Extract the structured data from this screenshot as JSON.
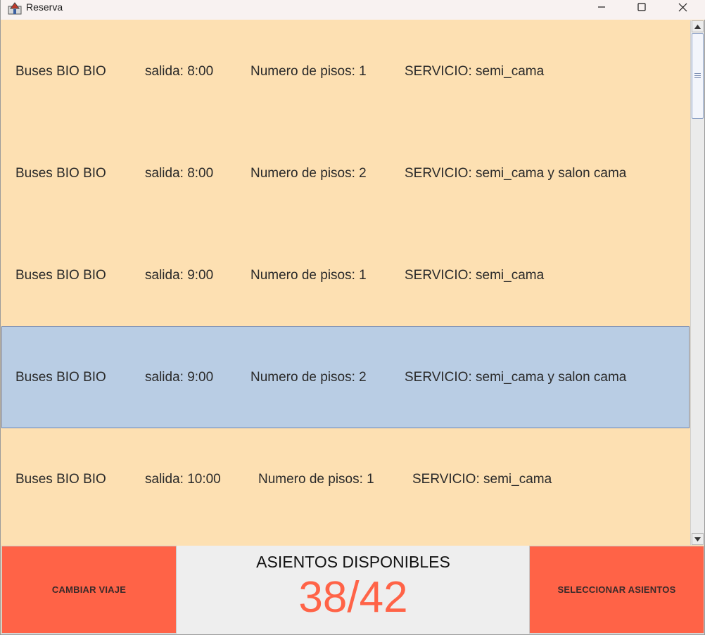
{
  "window": {
    "title": "Reserva",
    "icons": {
      "app": "java-app-icon",
      "minimize": "minimize-icon",
      "maximize": "maximize-icon",
      "close": "close-icon"
    }
  },
  "trips": [
    {
      "company": "Buses BIO BIO",
      "departure": "salida: 8:00",
      "floors": "Numero de pisos: 1",
      "service": "SERVICIO: semi_cama",
      "selected": false
    },
    {
      "company": "Buses BIO BIO",
      "departure": "salida: 8:00",
      "floors": "Numero de pisos: 2",
      "service": "SERVICIO: semi_cama y salon cama",
      "selected": false
    },
    {
      "company": "Buses BIO BIO",
      "departure": "salida: 9:00",
      "floors": "Numero de pisos: 1",
      "service": "SERVICIO: semi_cama",
      "selected": false
    },
    {
      "company": "Buses BIO BIO",
      "departure": "salida: 9:00",
      "floors": "Numero de pisos: 2",
      "service": "SERVICIO: semi_cama y salon cama",
      "selected": true
    },
    {
      "company": "Buses BIO BIO",
      "departure": "salida: 10:00",
      "floors": "Numero de pisos: 1",
      "service": "SERVICIO: semi_cama",
      "selected": false
    }
  ],
  "footer": {
    "change_trip_label": "CAMBIAR VIAJE",
    "seats_label": "ASIENTOS DISPONIBLES",
    "seats_value": "38/42",
    "select_seats_label": "SELECCIONAR ASIENTOS"
  },
  "colors": {
    "list_background": "#fde0b2",
    "selected_row": "#b9cde4",
    "accent": "#ff6347",
    "panel": "#eeeeee"
  }
}
